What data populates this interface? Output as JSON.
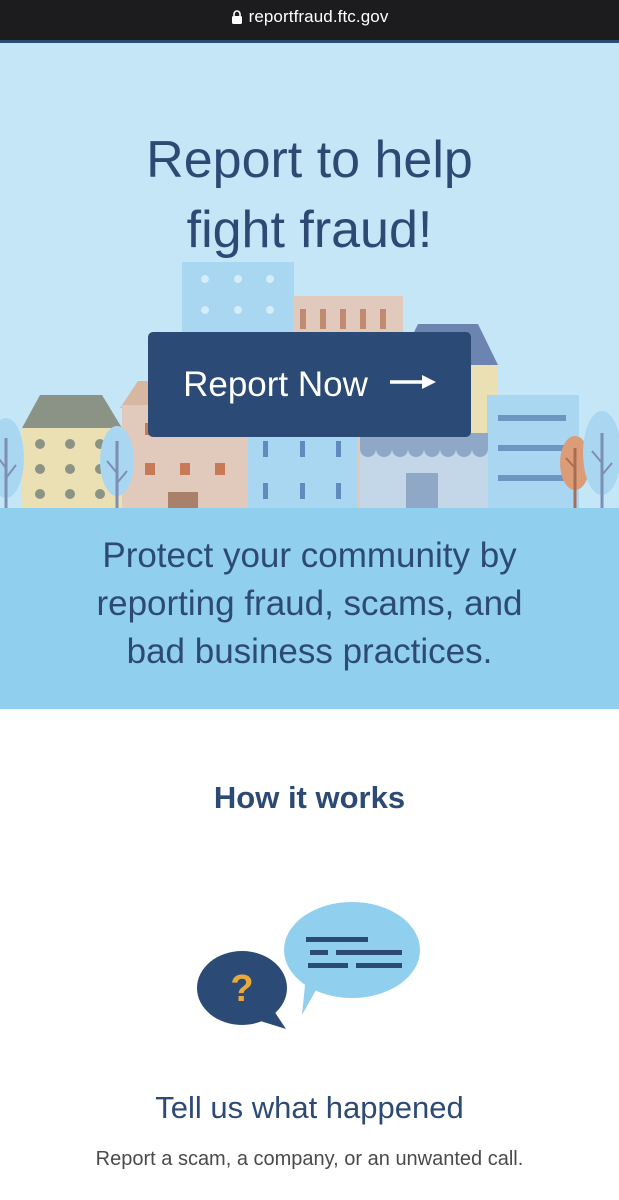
{
  "browser": {
    "url": "reportfraud.ftc.gov"
  },
  "hero": {
    "title_line1": "Report to help",
    "title_line2": "fight fraud!",
    "button_label": "Report Now"
  },
  "protect": {
    "line1": "Protect your community by",
    "line2": "reporting fraud, scams, and",
    "line3": "bad business practices."
  },
  "how_it_works": {
    "title": "How it works",
    "steps": [
      {
        "title": "Tell us what happened",
        "description": "Report a scam, a company, or an unwanted call.",
        "question_mark": "?"
      }
    ]
  },
  "colors": {
    "navy": "#2b4a75",
    "hero_bg": "#c5e6f6",
    "band_bg": "#90cfee",
    "accent_yellow": "#e9a83a"
  },
  "icons": {
    "lock": "lock-icon",
    "arrow": "arrow-right-icon",
    "illustration": "chat-bubbles-icon"
  }
}
